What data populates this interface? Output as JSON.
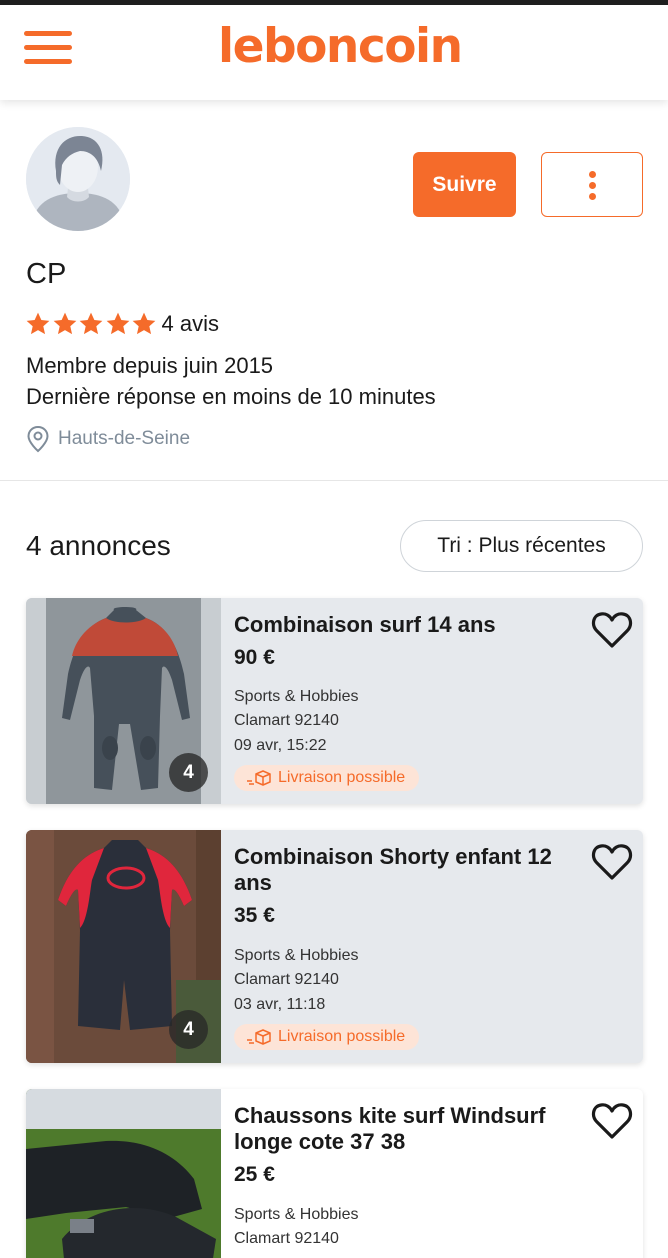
{
  "header": {
    "logo_text": "leboncoin",
    "menu_icon": "hamburger-icon"
  },
  "profile": {
    "name": "CP",
    "rating_stars": 5,
    "reviews": "4 avis",
    "member_since": "Membre depuis juin 2015",
    "response_time": "Dernière réponse en moins de 10 minutes",
    "location": "Hauts-de-Seine",
    "follow_label": "Suivre",
    "more_icon": "more-vertical-icon"
  },
  "listing": {
    "count_label": "4 annonces",
    "sort_label": "Tri : Plus récentes"
  },
  "ads": [
    {
      "title": "Combinaison surf 14 ans",
      "price": "90 €",
      "category": "Sports & Hobbies",
      "location": "Clamart 92140",
      "date": "09 avr, 15:22",
      "delivery": "Livraison possible",
      "photo_count": "4"
    },
    {
      "title": "Combinaison Shorty enfant 12 ans",
      "price": "35 €",
      "category": "Sports & Hobbies",
      "location": "Clamart 92140",
      "date": "03 avr, 11:18",
      "delivery": "Livraison possible",
      "photo_count": "4"
    },
    {
      "title": "Chaussons kite surf Windsurf longe cote 37 38",
      "price": "25 €",
      "category": "Sports & Hobbies",
      "location": "Clamart 92140"
    }
  ],
  "colors": {
    "brand": "#f56b2a",
    "card_bg": "#e6e9ed",
    "delivery_bg": "#fde4d7",
    "muted": "#7f8c99"
  }
}
